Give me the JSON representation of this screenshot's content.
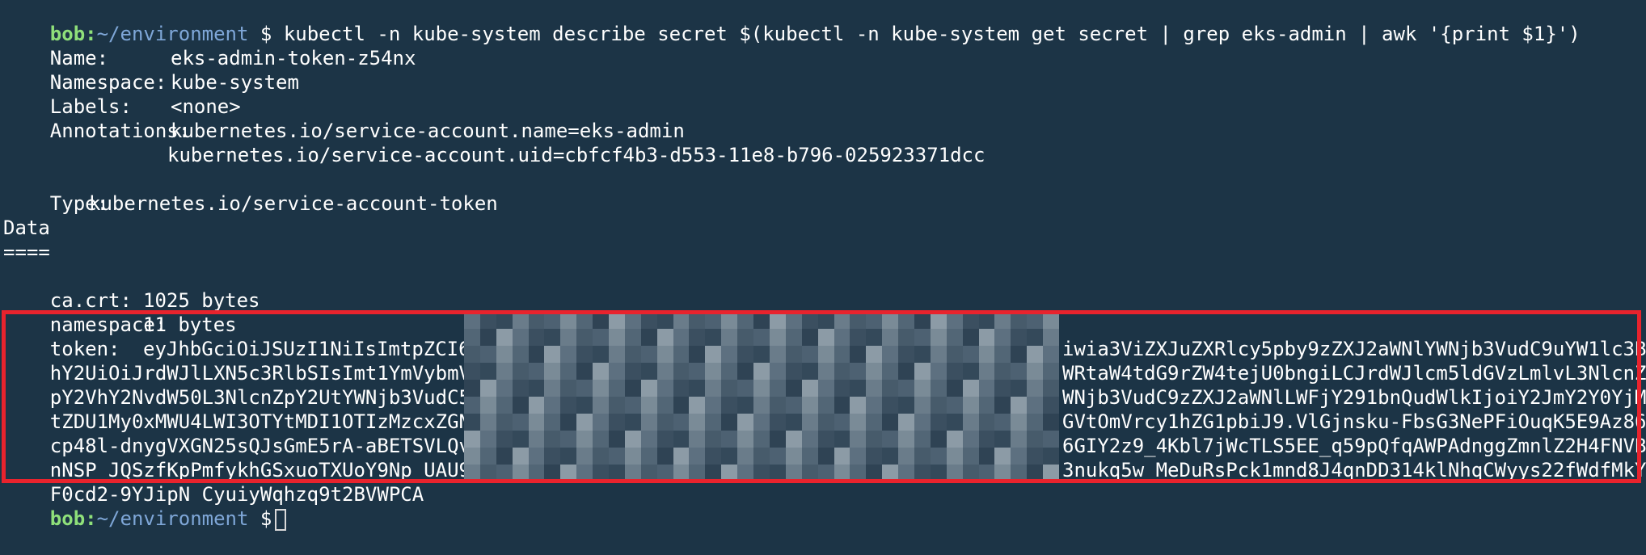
{
  "prompt": {
    "user": "bob",
    "path": "~/environment",
    "symbol": "$"
  },
  "command": "kubectl -n kube-system describe secret $(kubectl -n kube-system get secret | grep eks-admin | awk '{print $1}')",
  "fields": {
    "name_label": "Name:",
    "name_value": "eks-admin-token-z54nx",
    "namespace_label": "Namespace:",
    "namespace_value": "kube-system",
    "labels_label": "Labels:",
    "labels_value": "<none>",
    "annotations_label": "Annotations:",
    "annotation_1": "kubernetes.io/service-account.name=eks-admin",
    "annotation_2": "kubernetes.io/service-account.uid=cbfcf4b3-d553-11e8-b796-025923371dcc",
    "type_label": "Type:",
    "type_value": "kubernetes.io/service-account-token",
    "data_heading": "Data",
    "data_rule": "====",
    "ca_label": "ca.crt:",
    "ca_value": "1025 bytes",
    "ns_label": "namespace:",
    "ns_value": "11 bytes"
  },
  "token": {
    "label": "token:",
    "lines": [
      {
        "left": "eyJhbGciOiJSUzI1NiIsImtpZCI6",
        "right": "iwia3ViZXJuZXRlcy5pby9zZXJ2aWNlYWNjb3VudC9uYW1lc3B"
      },
      {
        "left": "hY2UiOiJrdWJlLXN5c3RlbSIsImt1YmVybmV0ZXN",
        "right": "WRtaW4tdG9rZW4tejU0bngiLCJrdWJlcm5ldGVzLmlvL3NlcnZ"
      },
      {
        "left": "pY2VhY2NvdW50L3NlcnZpY2UtYWNjb3VudC5uYW",
        "right": "WNjb3VudC9zZXJ2aWNlLWFjY291bnQudWlkIjoiY2JmY2Y0YjM"
      },
      {
        "left": "tZDU1My0xMWU4LWI3OTYtMDI1OTIzMzcxZGNjIiw",
        "right": "GVtOmVrcy1hZG1pbiJ9.VlGjnsku-FbsG3NePFiOuqK5E9Az86"
      },
      {
        "left": "cp48l-dnygVXGN25sQJsGmE5rA-aBETSVLQvOFWl",
        "right": "6GIY2z9_4Kbl7jWcTLS5EE_q59pQfqAWPAdnggZmnlZ2H4FNVB"
      },
      {
        "left": "nNSP_JQSzfKpPmfykhGSxuoTXUoY9Np_UAU9QUQy",
        "right": "3nukq5w_MeDuRsPck1mnd8J4qnDD314klNhqCWyys22fWdfMkY"
      },
      {
        "left": "F0cd2-9YJipN CyuiyWqhzq9t2BVWPCA",
        "right": ""
      }
    ]
  },
  "colors": {
    "background": "#1c3446",
    "highlight_box": "#e8232d",
    "user": "#8fe07a",
    "path": "#7fa7d8"
  }
}
